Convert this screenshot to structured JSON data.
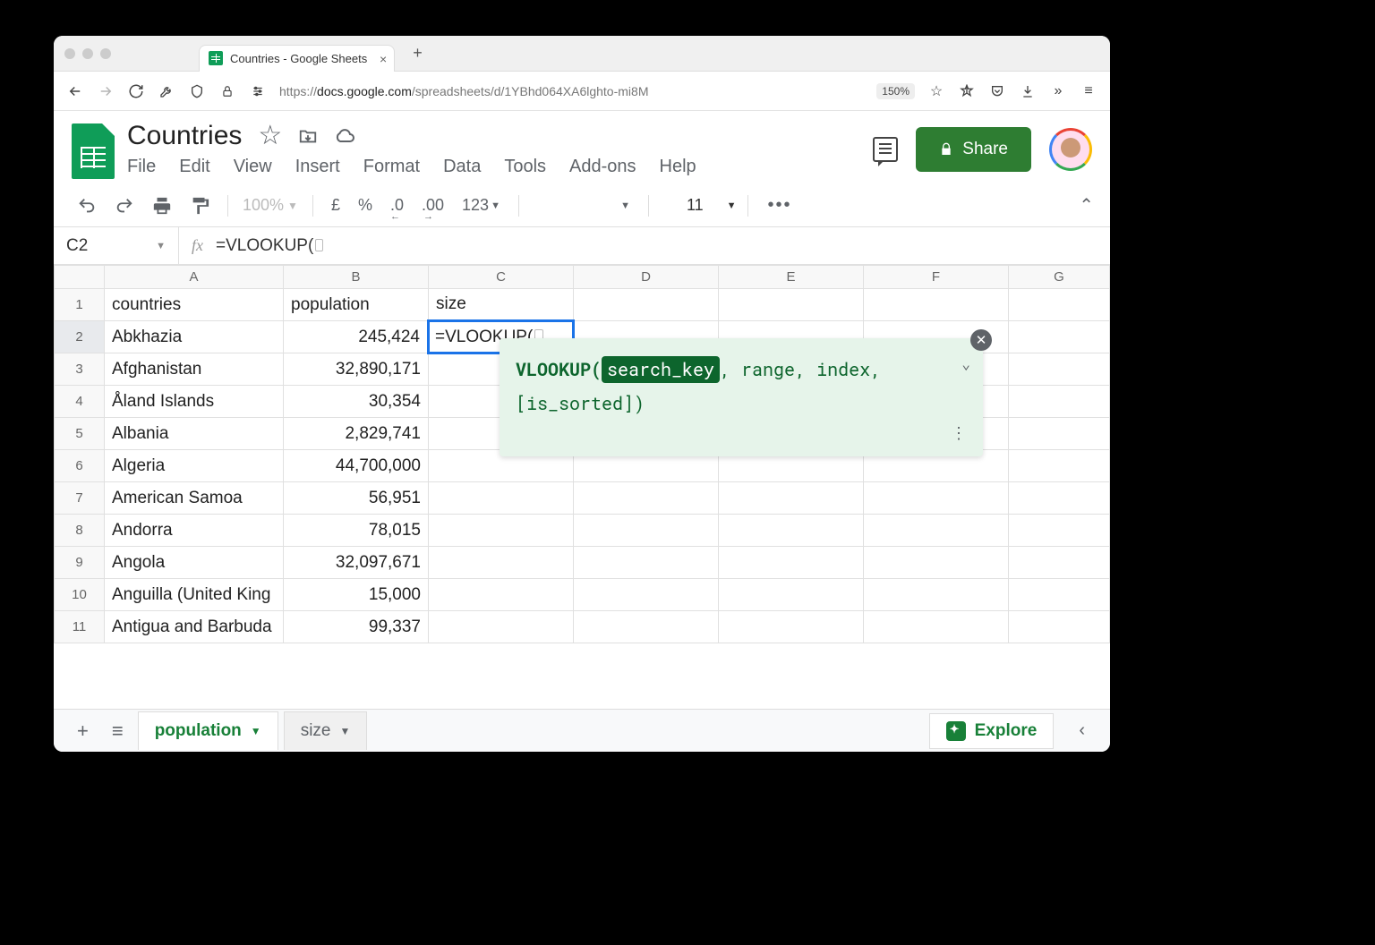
{
  "browser": {
    "tab_title": "Countries - Google Sheets",
    "url_prefix": "https://",
    "url_domain": "docs.google.com",
    "url_path": "/spreadsheets/d/1YBhd064XA6lghto-mi8M",
    "zoom": "150%"
  },
  "doc": {
    "title": "Countries",
    "menus": [
      "File",
      "Edit",
      "View",
      "Insert",
      "Format",
      "Data",
      "Tools",
      "Add-ons",
      "Help"
    ],
    "share": "Share"
  },
  "toolbar": {
    "zoom": "100%",
    "currency": "£",
    "percent": "%",
    "dec_dec": ".0",
    "dec_inc": ".00",
    "numfmt": "123",
    "fontsize": "11"
  },
  "formula_bar": {
    "cell": "C2",
    "formula": "=VLOOKUP("
  },
  "grid": {
    "columns": [
      "A",
      "B",
      "C",
      "D",
      "E",
      "F",
      "G"
    ],
    "active_cell_text": "=VLOOKUP(",
    "headers": {
      "A": "countries",
      "B": "population",
      "C": "size"
    },
    "rows": [
      {
        "n": "1",
        "A": "countries",
        "B": "population",
        "C": "size"
      },
      {
        "n": "2",
        "A": "Abkhazia",
        "B": "245,424",
        "C": "=VLOOKUP(",
        "active": true
      },
      {
        "n": "3",
        "A": "Afghanistan",
        "B": "32,890,171"
      },
      {
        "n": "4",
        "A": "Åland Islands",
        "B": "30,354"
      },
      {
        "n": "5",
        "A": "Albania",
        "B": "2,829,741"
      },
      {
        "n": "6",
        "A": "Algeria",
        "B": "44,700,000"
      },
      {
        "n": "7",
        "A": "American Samoa",
        "B": "56,951"
      },
      {
        "n": "8",
        "A": "Andorra",
        "B": "78,015"
      },
      {
        "n": "9",
        "A": "Angola",
        "B": "32,097,671"
      },
      {
        "n": "10",
        "A": "Anguilla (United King",
        "B": "15,000"
      },
      {
        "n": "11",
        "A": "Antigua and Barbuda",
        "B": "99,337"
      }
    ]
  },
  "tooltip": {
    "fn": "VLOOKUP(",
    "arg1": "search_key",
    "rest1": ", range, index,",
    "rest2": "[is_sorted])"
  },
  "sheets": {
    "tab1": "population",
    "tab2": "size",
    "explore": "Explore"
  }
}
